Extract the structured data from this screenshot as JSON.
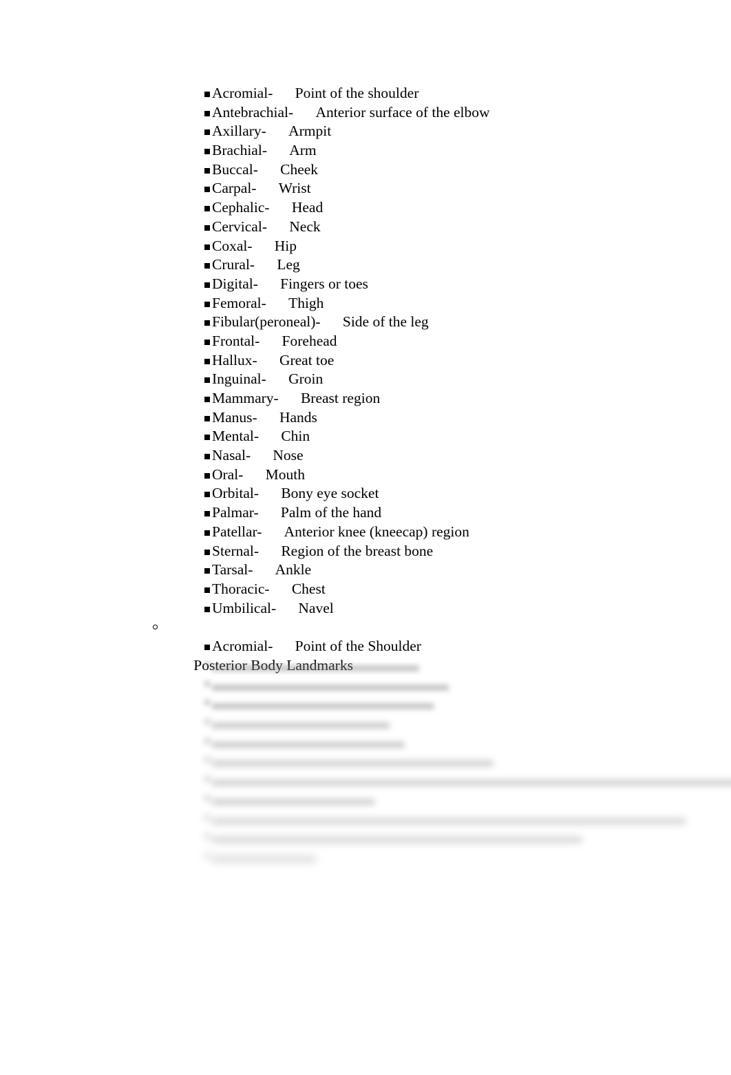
{
  "document": {
    "background_color": "#ffffff",
    "text_color": "#000000",
    "anterior_landmarks": [
      {
        "term": "Acromial-",
        "definition": "Point of the shoulder"
      },
      {
        "term": "Antebrachial-",
        "definition": "Anterior surface of the elbow"
      },
      {
        "term": "Axillary-",
        "definition": "Armpit"
      },
      {
        "term": "Brachial-",
        "definition": "Arm"
      },
      {
        "term": "Buccal-",
        "definition": "Cheek"
      },
      {
        "term": "Carpal-",
        "definition": "Wrist"
      },
      {
        "term": "Cephalic-",
        "definition": "Head"
      },
      {
        "term": "Cervical-",
        "definition": "Neck"
      },
      {
        "term": "Coxal-",
        "definition": "Hip"
      },
      {
        "term": "Crural-",
        "definition": "Leg"
      },
      {
        "term": "Digital-",
        "definition": "Fingers or toes"
      },
      {
        "term": "Femoral-",
        "definition": "Thigh"
      },
      {
        "term": "Fibular(peroneal)-",
        "definition": "Side of the leg"
      },
      {
        "term": "Frontal-",
        "definition": "Forehead"
      },
      {
        "term": "Hallux-",
        "definition": "Great toe"
      },
      {
        "term": "Inguinal-",
        "definition": "Groin"
      },
      {
        "term": "Mammary-",
        "definition": "Breast region"
      },
      {
        "term": "Manus-",
        "definition": "Hands"
      },
      {
        "term": "Mental-",
        "definition": "Chin"
      },
      {
        "term": "Nasal-",
        "definition": "Nose"
      },
      {
        "term": "Oral-",
        "definition": "Mouth"
      },
      {
        "term": "Orbital-",
        "definition": "Bony eye socket"
      },
      {
        "term": "Palmar-",
        "definition": "Palm of the hand"
      },
      {
        "term": "Patellar-",
        "definition": "Anterior knee (kneecap) region"
      },
      {
        "term": "Sternal-",
        "definition": "Region of the breast bone"
      },
      {
        "term": "Tarsal-",
        "definition": "Ankle"
      },
      {
        "term": "Thoracic-",
        "definition": "Chest"
      },
      {
        "term": "Umbilical-",
        "definition": "Navel"
      }
    ],
    "posterior_heading": "Posterior Body Landmarks",
    "posterior_landmarks": [
      {
        "term": "Acromial-",
        "definition": "Point of the Shoulder"
      }
    ],
    "obscured_lines": [
      "                            ",
      "                                ",
      "                              ",
      "                        ",
      "                          ",
      "                                      ",
      "                                                                             ",
      "                      ",
      "                                                                ",
      "                                                  ",
      "              "
    ]
  }
}
